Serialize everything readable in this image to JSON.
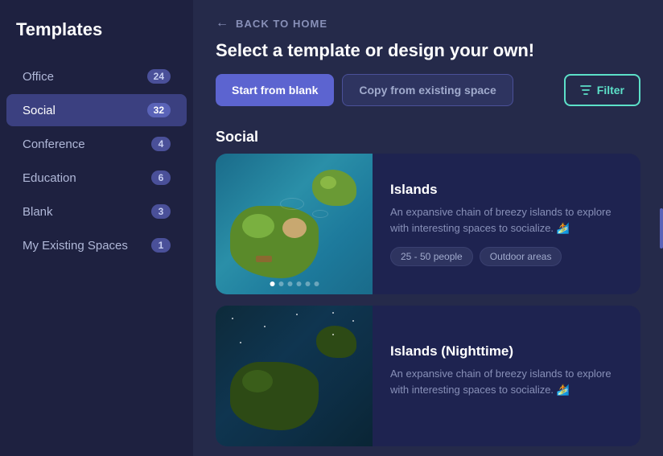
{
  "sidebar": {
    "title": "Templates",
    "items": [
      {
        "id": "office",
        "label": "Office",
        "count": "24",
        "active": false
      },
      {
        "id": "social",
        "label": "Social",
        "count": "32",
        "active": true
      },
      {
        "id": "conference",
        "label": "Conference",
        "count": "4",
        "active": false
      },
      {
        "id": "education",
        "label": "Education",
        "count": "6",
        "active": false
      },
      {
        "id": "blank",
        "label": "Blank",
        "count": "3",
        "active": false
      },
      {
        "id": "my-existing",
        "label": "My Existing Spaces",
        "count": "1",
        "active": false
      }
    ]
  },
  "header": {
    "back_label": "BACK TO HOME",
    "title": "Select a template or design your own!",
    "btn_blank": "Start from blank",
    "btn_copy": "Copy from existing space",
    "btn_filter": "Filter"
  },
  "section_label": "Social",
  "cards": [
    {
      "id": "islands",
      "title": "Islands",
      "description": "An expansive chain of breezy islands to explore with interesting spaces to socialize. 🏄",
      "tags": [
        "25 - 50 people",
        "Outdoor areas"
      ],
      "dots": 6,
      "active_dot": 0,
      "theme": "day"
    },
    {
      "id": "islands-night",
      "title": "Islands (Nighttime)",
      "description": "An expansive chain of breezy islands to explore with interesting spaces to socialize. 🏄",
      "tags": [],
      "dots": 0,
      "theme": "night"
    }
  ]
}
